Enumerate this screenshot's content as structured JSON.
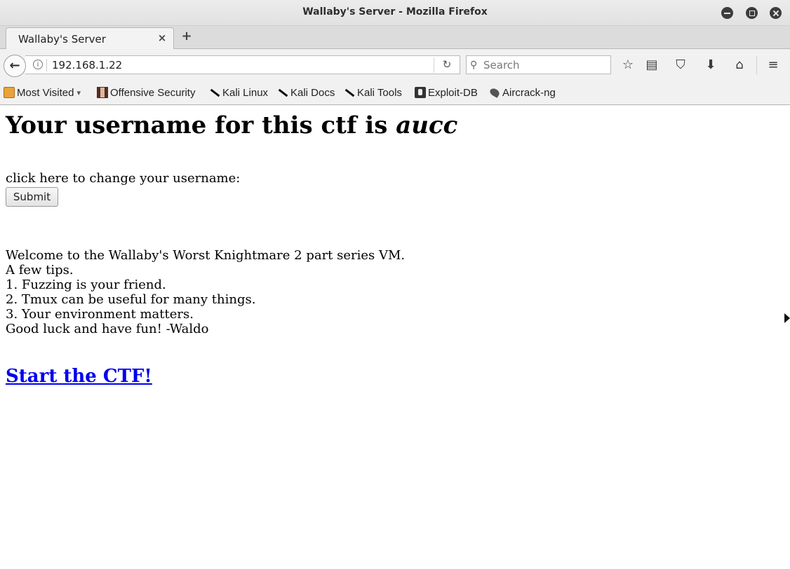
{
  "window": {
    "title": "Wallaby's Server - Mozilla Firefox",
    "controls": [
      "minimize-icon",
      "maximize-icon",
      "close-icon"
    ]
  },
  "tabs": [
    {
      "label": "Wallaby's Server",
      "close_icon": "×"
    }
  ],
  "new_tab_icon": "+",
  "navbar": {
    "back_icon": "←",
    "info_icon": "i",
    "url": "192.168.1.22",
    "reload_icon": "↻",
    "search_icon": "🔍",
    "search_placeholder": "Search",
    "icons": {
      "bookmark": "☆",
      "reading_list": "▤",
      "pocket": "⛉",
      "downloads": "⬇",
      "home": "⌂",
      "menu": "≡"
    }
  },
  "bookmarks": [
    {
      "label": "Most Visited",
      "icon": "folder-icon",
      "has_dropdown": true,
      "dropdown_icon": "▾"
    },
    {
      "label": "Offensive Security",
      "icon": "offsec-icon"
    },
    {
      "label": "Kali Linux",
      "icon": "dragon-icon"
    },
    {
      "label": "Kali Docs",
      "icon": "dragon-icon"
    },
    {
      "label": "Kali Tools",
      "icon": "dragon-icon"
    },
    {
      "label": "Exploit-DB",
      "icon": "exploit-icon"
    },
    {
      "label": "Aircrack-ng",
      "icon": "aircrack-icon"
    }
  ],
  "page": {
    "heading_prefix": "Your username for this ctf is ",
    "username": "aucc",
    "change_label": "click here to change your username:",
    "submit_label": "Submit",
    "welcome_lines": [
      "Welcome to the Wallaby's Worst Knightmare 2 part series VM.",
      "A few tips.",
      "1. Fuzzing is your friend.",
      "2. Tmux can be useful for many things.",
      "3. Your environment matters.",
      "Good luck and have fun! -Waldo"
    ],
    "start_link": "Start the CTF!"
  }
}
